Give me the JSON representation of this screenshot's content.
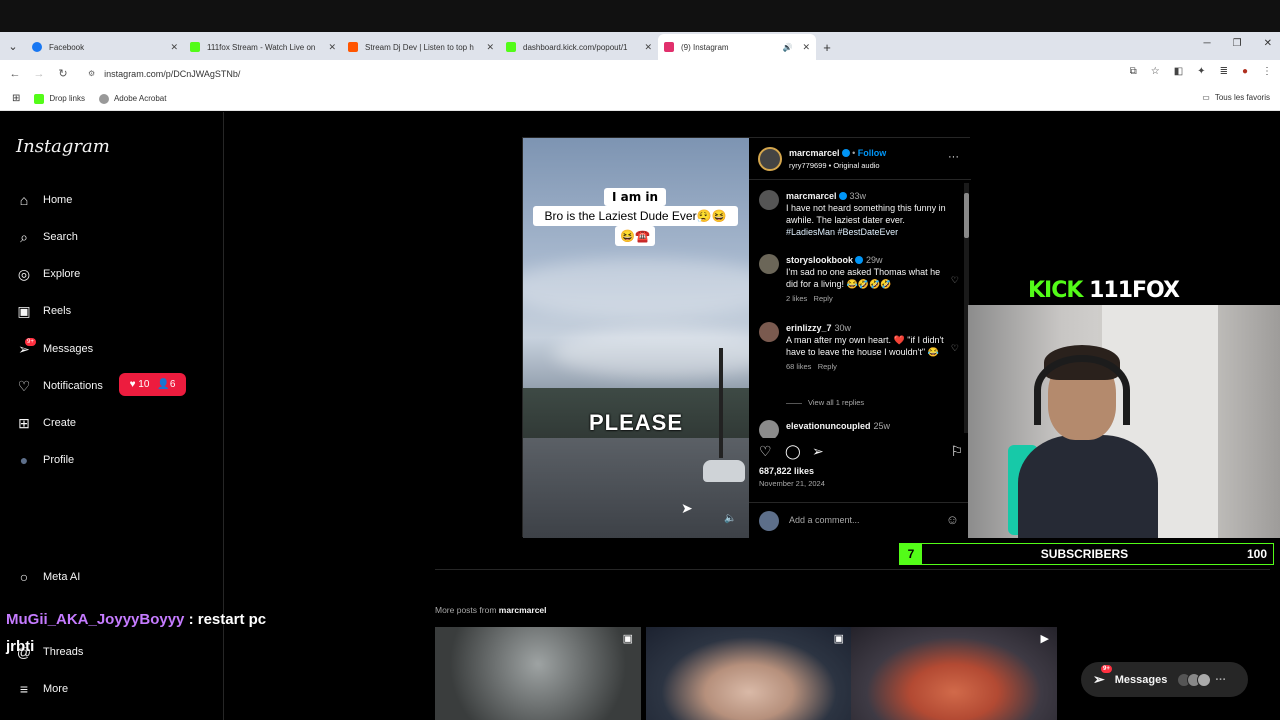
{
  "browser": {
    "tabs": [
      {
        "title": "Facebook",
        "color": "#1877f2"
      },
      {
        "title": "111fox Stream - Watch Live on",
        "color": "#53fc18"
      },
      {
        "title": "Stream Dj Dev | Listen to top h",
        "color": "#ff5500"
      },
      {
        "title": "dashboard.kick.com/popout/1",
        "color": "#53fc18"
      },
      {
        "title": "(9) Instagram",
        "color": "#e1306c"
      }
    ],
    "url": "instagram.com/p/DCnJWAgSTNb/",
    "bookmarks": [
      {
        "label": "Drop links",
        "color": "#53fc18"
      },
      {
        "label": "Adobe Acrobat",
        "color": "#999"
      }
    ],
    "bookmarks_right": "Tous les favoris"
  },
  "sidebar": {
    "logo": "Instagram",
    "items": [
      {
        "label": "Home",
        "icon": "⌂"
      },
      {
        "label": "Search",
        "icon": "⌕"
      },
      {
        "label": "Explore",
        "icon": "◎"
      },
      {
        "label": "Reels",
        "icon": "▣"
      },
      {
        "label": "Messages",
        "icon": "➢"
      },
      {
        "label": "Notifications",
        "icon": "♡"
      },
      {
        "label": "Create",
        "icon": "⊞"
      },
      {
        "label": "Profile",
        "icon": "●"
      },
      {
        "label": "Meta AI",
        "icon": "○"
      },
      {
        "label": "Threads",
        "icon": "@"
      },
      {
        "label": "More",
        "icon": "≡"
      }
    ],
    "messages_badge": "9+",
    "notifications": {
      "likes": "10",
      "follows": "6"
    }
  },
  "chat_overlay": {
    "user": "MuGii_AKA_JoyyyBoyyy",
    "sep": " : ",
    "message": "restart pc jrbti"
  },
  "post": {
    "video": {
      "caption_top": "I am in tears",
      "caption_main": "Bro is the Laziest Dude Ever😮‍💨😆",
      "caption_emoji": "😆☎️",
      "overlay_text": "PLEASE"
    },
    "author": "marcmarcel",
    "follow_label": "Follow",
    "audio": "ryry779699 • Original audio",
    "comments": [
      {
        "user": "marcmarcel",
        "time": "33w",
        "text": "I have not heard something this funny in awhile. The laziest dater ever.",
        "tags": "#LadiesMan #BestDateEver",
        "likes": "",
        "reply": ""
      },
      {
        "user": "storyslookbook",
        "time": "29w",
        "text": "I'm sad no one asked Thomas what he did for a living! 😂🤣🤣🤣",
        "tags": "",
        "likes": "2 likes",
        "reply": "Reply"
      },
      {
        "user": "erinlizzy_7",
        "time": "30w",
        "text": "A man after my own heart. ❤️ \"if I didn't have to leave the house I wouldn't\" 😂",
        "tags": "",
        "likes": "68 likes",
        "reply": "Reply"
      },
      {
        "user": "elevationuncoupled",
        "time": "25w",
        "text": "",
        "tags": "",
        "likes": "",
        "reply": ""
      }
    ],
    "view_replies": "View all 1 replies",
    "likes": "687,822 likes",
    "date": "November 21, 2024",
    "add_comment_placeholder": "Add a comment..."
  },
  "stream": {
    "kick_brand": "KICK",
    "channel": "111FOX",
    "subs_count": "7",
    "subs_label": "SUBSCRIBERS",
    "subs_goal": "100"
  },
  "more_posts": {
    "prefix": "More posts from",
    "user": "marcmarcel"
  },
  "messages_button": {
    "label": "Messages",
    "badge": "9+"
  }
}
